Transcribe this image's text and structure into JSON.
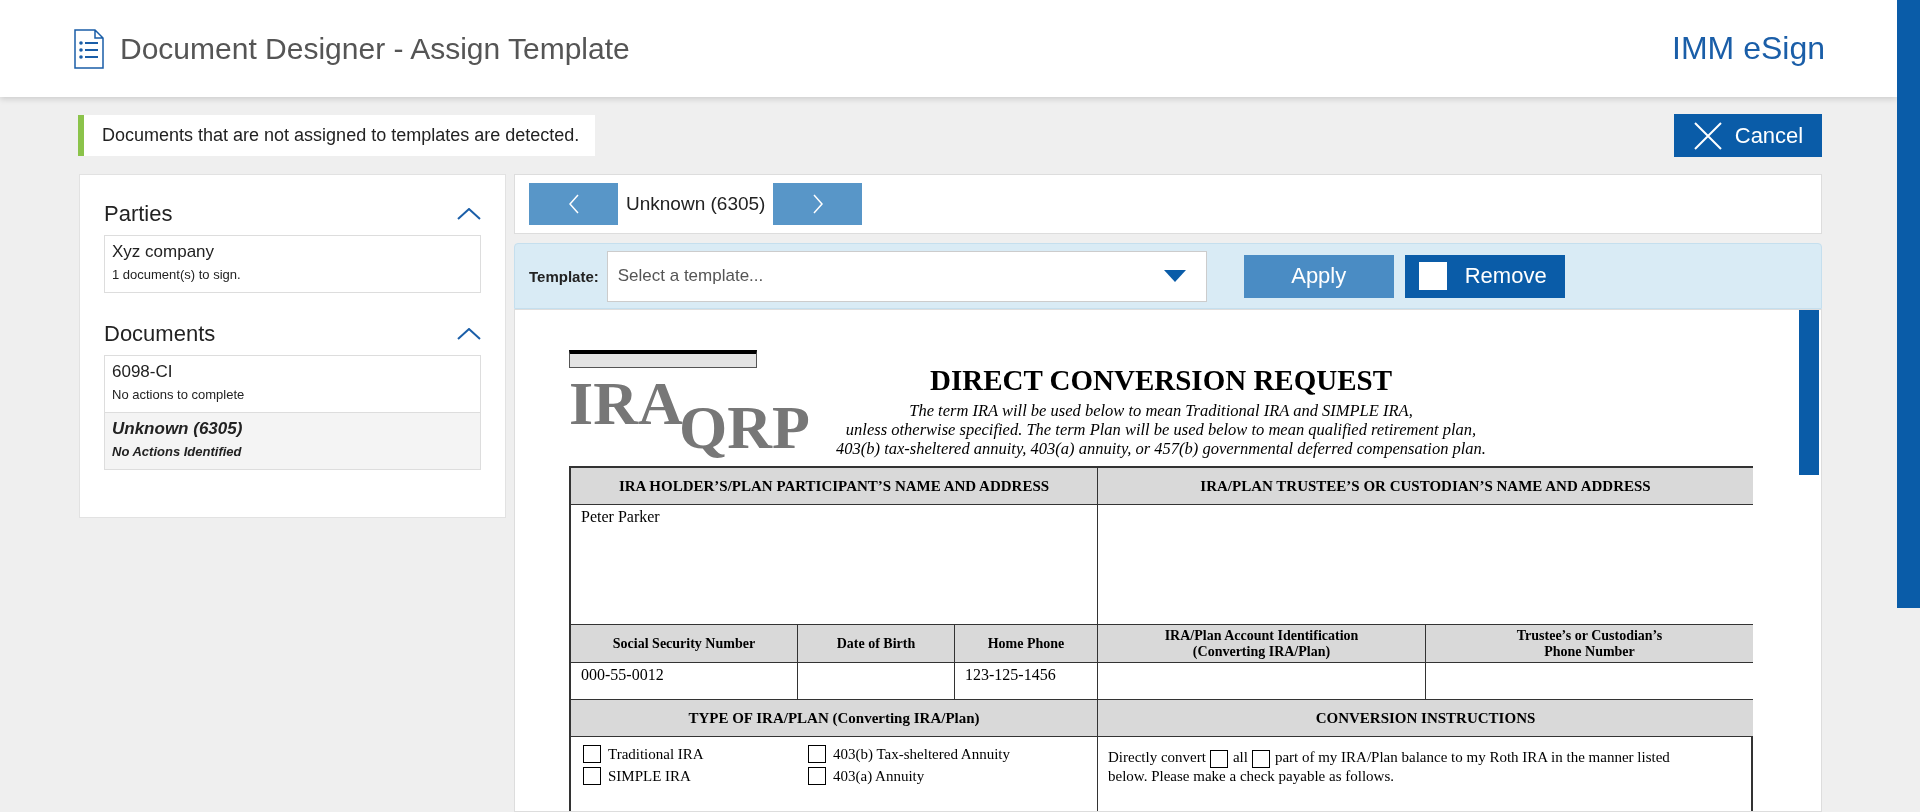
{
  "header": {
    "title": "Document Designer - Assign Template",
    "brand": "IMM eSign"
  },
  "alert": {
    "message": "Documents that are not assigned to templates are detected."
  },
  "cancel_button": {
    "label": "Cancel"
  },
  "parties": {
    "title": "Parties",
    "expanded": true,
    "items": [
      {
        "name": "Xyz company",
        "detail": "1 document(s) to sign.",
        "selected": false
      }
    ]
  },
  "documents": {
    "title": "Documents",
    "expanded": true,
    "items": [
      {
        "name": "6098-CI",
        "detail": "No actions to complete",
        "selected": false
      },
      {
        "name": "Unknown (6305)",
        "detail": "No Actions Identified",
        "selected": true
      }
    ]
  },
  "navigator": {
    "current": "Unknown (6305)"
  },
  "template": {
    "label": "Template:",
    "placeholder": "Select a template...",
    "apply": "Apply",
    "remove": "Remove"
  },
  "document": {
    "logo_top": "IRA",
    "logo_bottom": "QRP",
    "title": "DIRECT CONVERSION REQUEST",
    "intro": [
      "The term IRA will be used below to mean Traditional IRA and SIMPLE IRA,",
      "unless otherwise specified. The term Plan will be used below to mean qualified retirement plan,",
      "403(b) tax-sheltered annuity, 403(a) annuity, or 457(b) governmental deferred compensation plan."
    ],
    "rows": [
      {
        "kind": "head",
        "cells": [
          {
            "text": "IRA HOLDER’S/PLAN PARTICIPANT’S NAME AND ADDRESS"
          },
          {
            "text": "IRA/PLAN TRUSTEE’S OR CUSTODIAN’S NAME AND ADDRESS"
          }
        ]
      },
      {
        "kind": "tall",
        "cells": [
          {
            "text": "Peter Parker"
          },
          {}
        ]
      },
      {
        "kind": "subhead",
        "cells": [
          {
            "text": "Social Security Number"
          },
          {
            "text": "Date of Birth"
          },
          {
            "text": "Home Phone"
          },
          {
            "text": "IRA/Plan Account Identification\n(Converting IRA/Plan)"
          },
          {
            "text": "Trustee’s or Custodian’s\nPhone Number"
          }
        ]
      },
      {
        "kind": "value",
        "cells": [
          {
            "text": "000-55-0012"
          },
          {},
          {
            "text": "123-125-1456"
          },
          {},
          {}
        ]
      },
      {
        "kind": "head",
        "cells": [
          {
            "text": "TYPE OF IRA/PLAN (Converting IRA/Plan)"
          },
          {
            "text": "CONVERSION INSTRUCTIONS"
          }
        ]
      }
    ],
    "plan_types": [
      {
        "label": "Traditional IRA",
        "checked": false
      },
      {
        "label": "403(b) Tax-sheltered Annuity",
        "checked": false
      },
      {
        "label": "SIMPLE IRA",
        "checked": false
      },
      {
        "label": "403(a) Annuity",
        "checked": false
      }
    ],
    "instructions": {
      "before": "Directly convert",
      "all": {
        "label": "all",
        "checked": false
      },
      "part": {
        "label": "part of my IRA/Plan balance to my Roth IRA in the manner listed",
        "checked": false
      },
      "after": "below. Please make a check payable as follows."
    }
  }
}
